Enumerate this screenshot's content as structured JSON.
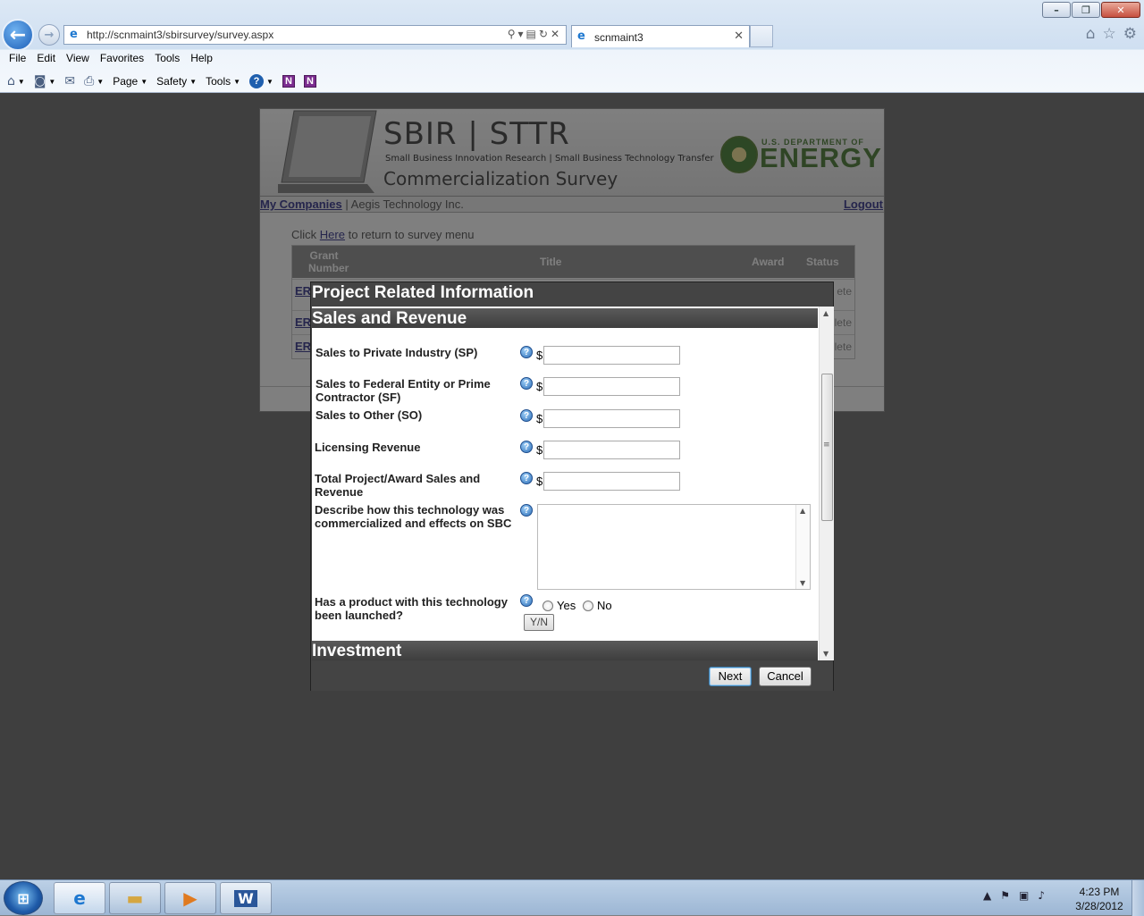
{
  "browser": {
    "url": "http://scnmaint3/sbirsurvey/survey.aspx",
    "tab_title": "scnmaint3",
    "menu": [
      "File",
      "Edit",
      "View",
      "Favorites",
      "Tools",
      "Help"
    ],
    "commands": {
      "page": "Page",
      "safety": "Safety",
      "tools": "Tools"
    }
  },
  "page": {
    "banner_title": "SBIR | STTR",
    "banner_subtitle": "Small Business Innovation Research | Small Business Technology Transfer",
    "banner_survey": "Commercialization Survey",
    "doe_small": "U.S. DEPARTMENT OF",
    "doe_big": "ENERGY",
    "my_companies": "My Companies",
    "company_name": "| Aegis Technology Inc.",
    "logout": "Logout",
    "return_prefix": "Click",
    "return_link": "Here",
    "return_suffix": "to return to survey menu",
    "grid_headers": {
      "grant": "Grant Number",
      "title": "Title",
      "award": "Award",
      "status": "Status"
    },
    "grid_rows": [
      {
        "grant": "ER",
        "status": "ete"
      },
      {
        "grant": "ER",
        "status": "lete"
      },
      {
        "grant": "ER",
        "status": "lete"
      }
    ]
  },
  "modal": {
    "title": "Project Related Information",
    "section_sales": "Sales and Revenue",
    "section_investment": "Investment",
    "fields": {
      "sp": {
        "label": "Sales to Private Industry (SP)",
        "currency": "$",
        "value": ""
      },
      "sf": {
        "label": "Sales to Federal Entity or Prime Contractor (SF)",
        "currency": "$",
        "value": ""
      },
      "so": {
        "label": "Sales to Other (SO)",
        "currency": "$",
        "value": ""
      },
      "lic": {
        "label": "Licensing Revenue",
        "currency": "$",
        "value": ""
      },
      "total": {
        "label": "Total Project/Award Sales and Revenue",
        "currency": "$",
        "value": ""
      },
      "describe": {
        "label": "Describe how this technology was commercialized and effects on SBC",
        "value": ""
      },
      "launched": {
        "label": "Has a product with this technology been launched?",
        "yes": "Yes",
        "no": "No",
        "yn_button": "Y/N"
      }
    },
    "help_glyph": "?",
    "buttons": {
      "next": "Next",
      "cancel": "Cancel"
    }
  },
  "taskbar": {
    "time": "4:23 PM",
    "date": "3/28/2012"
  }
}
